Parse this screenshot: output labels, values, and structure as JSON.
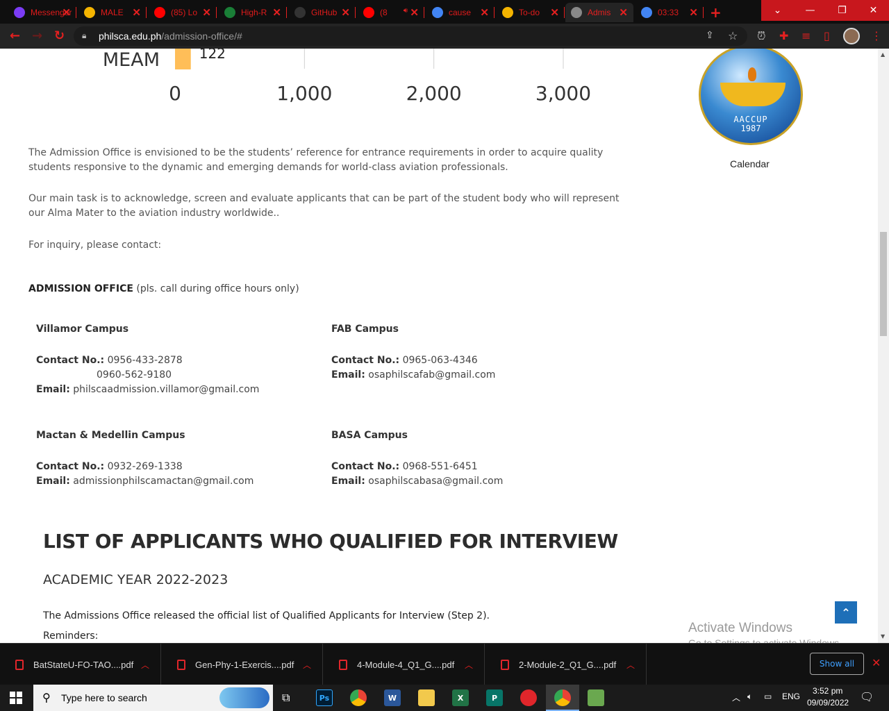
{
  "browser": {
    "tabs": [
      {
        "title": "Messenger",
        "icon": "messenger-icon",
        "color": "#7b3cf5"
      },
      {
        "title": "MALE",
        "icon": "drive-icon",
        "color": "#f4b400"
      },
      {
        "title": "(85) Lo",
        "icon": "youtube-icon",
        "color": "#ff0000"
      },
      {
        "title": "High-R",
        "icon": "imu-icon",
        "color": "#1a7f37"
      },
      {
        "title": "GitHub",
        "icon": "github-icon",
        "color": "#333333"
      },
      {
        "title": "(8",
        "icon": "youtube-icon",
        "color": "#ff0000",
        "audio": true
      },
      {
        "title": "cause",
        "icon": "google-icon",
        "color": "#4285f4"
      },
      {
        "title": "To-do",
        "icon": "classroom-icon",
        "color": "#f4b400"
      },
      {
        "title": "Admis",
        "icon": "philsca-icon",
        "color": "#888888",
        "active": true
      },
      {
        "title": "03:33",
        "icon": "google-icon",
        "color": "#4285f4"
      }
    ],
    "url_host": "philsca.edu.ph",
    "url_path": "/admission-office/#"
  },
  "chart_data": {
    "type": "bar",
    "orientation": "horizontal",
    "categories": [
      "MEAM"
    ],
    "values": [
      122
    ],
    "data_labels": [
      "122"
    ],
    "xlim": [
      0,
      3000
    ],
    "xticks": [
      "0",
      "1,000",
      "2,000",
      "3,000"
    ],
    "grid": true,
    "bar_color": "#ffbe58"
  },
  "sidebar": {
    "badge_top_text": "AACCUP",
    "badge_year": "1987",
    "calendar_label": "Calendar"
  },
  "content": {
    "para1": "The Admission Office is envisioned to be the students’ reference for entrance requirements in order to acquire quality students responsive to the dynamic and emerging demands for world-class aviation professionals.",
    "para2": "Our main task is to acknowledge, screen and evaluate applicants that can be part of the student body who will represent our Alma Mater to the aviation industry worldwide..",
    "para3": "For inquiry, please contact:",
    "office_heading": "ADMISSION OFFICE",
    "office_note": " (pls. call during office hours only)",
    "contact_label": "Contact No.:",
    "email_label": "Email:",
    "campuses": [
      {
        "name": "Villamor Campus",
        "phones": [
          "0956-433-2878",
          "0960-562-9180"
        ],
        "email": "philscaadmission.villamor@gmail.com"
      },
      {
        "name": "FAB Campus",
        "phones": [
          "0965-063-4346"
        ],
        "email": "osaphilscafab@gmail.com"
      },
      {
        "name": "Mactan & Medellin Campus",
        "phones": [
          "0932-269-1338"
        ],
        "email": "admissionphilscamactan@gmail.com"
      },
      {
        "name": "BASA Campus",
        "phones": [
          "0968-551-6451"
        ],
        "email": "osaphilscabasa@gmail.com"
      }
    ],
    "list_heading": "LIST OF APPLICANTS WHO QUALIFIED FOR INTERVIEW",
    "academic_year": "ACADEMIC YEAR 2022-2023",
    "release_note": "The Admissions Office released the official list of Qualified Applicants for Interview (Step 2).",
    "reminders": "Reminders:"
  },
  "watermark": {
    "line1": "Activate Windows",
    "line2": "Go to Settings to activate Windows."
  },
  "downloads": {
    "items": [
      "BatStateU-FO-TAO....pdf",
      "Gen-Phy-1-Exercis....pdf",
      "4-Module-4_Q1_G....pdf",
      "2-Module-2_Q1_G....pdf"
    ],
    "show_all": "Show all"
  },
  "taskbar": {
    "search_placeholder": "Type here to search",
    "lang": "ENG",
    "time": "3:52 pm",
    "date": "09/09/2022"
  }
}
